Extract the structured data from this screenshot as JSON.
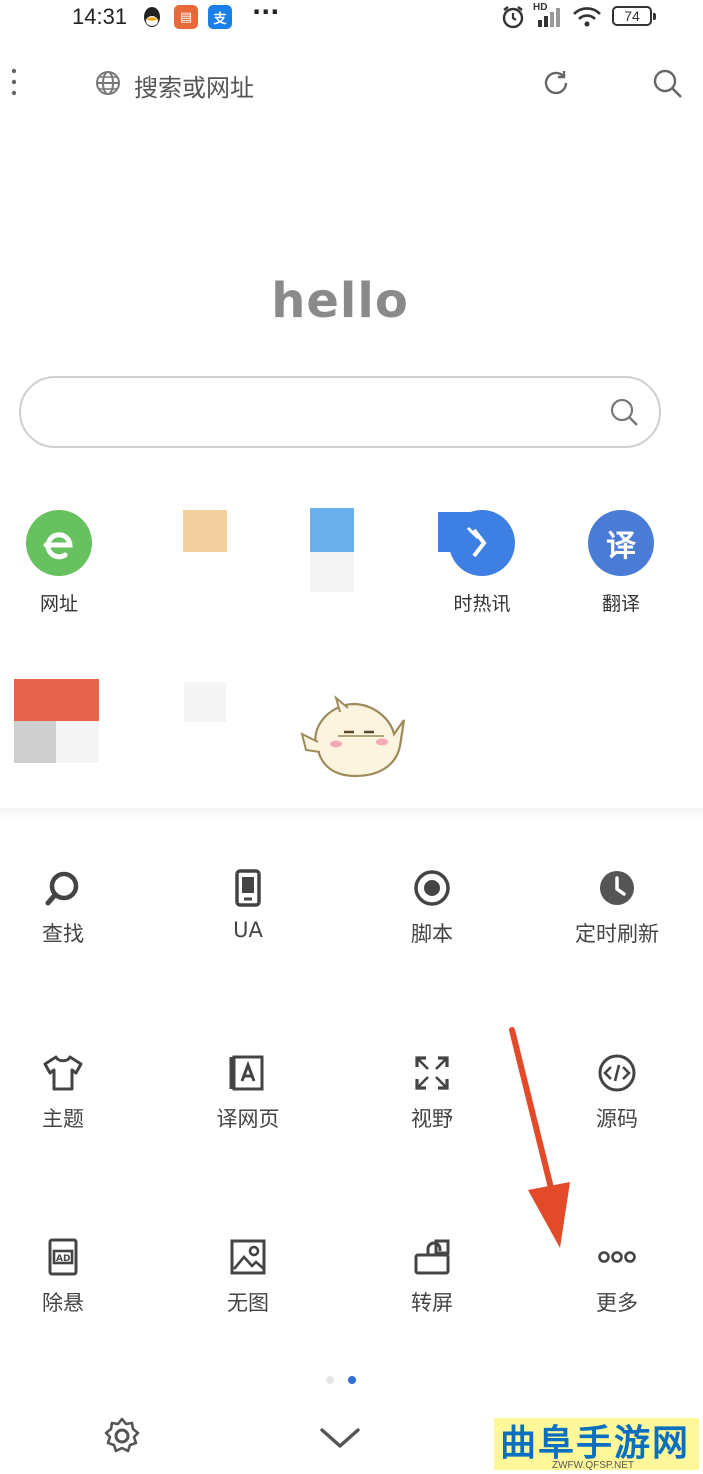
{
  "status_bar": {
    "time": "14:31",
    "more": "···",
    "battery": "74",
    "network": "HD"
  },
  "address_bar": {
    "placeholder": "搜索或网址"
  },
  "home": {
    "greeting": "hello"
  },
  "shortcuts": [
    {
      "label": "网址",
      "icon": "browser-e-icon",
      "color": "#67c15e"
    },
    {
      "label": "",
      "icon": "blurred-tile-icon",
      "color": "#f3cfa0"
    },
    {
      "label": "",
      "icon": "blurred-tile-icon",
      "color": "#6ab0ec"
    },
    {
      "label": "时热讯",
      "icon": "hot-news-icon",
      "color": "#3d7fe3"
    },
    {
      "label": "翻译",
      "icon": "translate-icon",
      "color": "#4a7cd6",
      "glyph": "译"
    }
  ],
  "tools": [
    {
      "label": "查找",
      "icon": "search-icon"
    },
    {
      "label": "UA",
      "icon": "phone-icon"
    },
    {
      "label": "脚本",
      "icon": "script-icon"
    },
    {
      "label": "定时刷新",
      "icon": "clock-icon"
    },
    {
      "label": "主题",
      "icon": "tshirt-icon"
    },
    {
      "label": "译网页",
      "icon": "translate-page-icon"
    },
    {
      "label": "视野",
      "icon": "fullscreen-icon"
    },
    {
      "label": "源码",
      "icon": "code-icon"
    },
    {
      "label": "除悬",
      "icon": "remove-float-icon"
    },
    {
      "label": "无图",
      "icon": "no-image-icon"
    },
    {
      "label": "转屏",
      "icon": "rotate-screen-icon"
    },
    {
      "label": "更多",
      "icon": "more-icon"
    }
  ],
  "pager": {
    "pages": 2,
    "current": 2
  },
  "colors": {
    "accent": "#2f6fd6",
    "arrow": "#e24a2a"
  },
  "watermark": {
    "text": "曲阜手游网",
    "url": "ZWFW.QFSP.NET"
  }
}
